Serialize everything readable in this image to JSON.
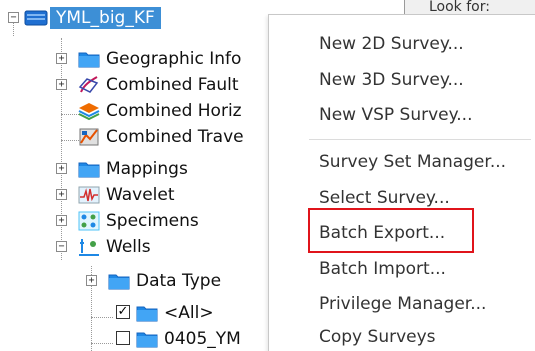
{
  "tree": {
    "root": {
      "label": "YML_big_KF",
      "expander": "−"
    },
    "items": [
      {
        "label": "Geographic Info",
        "expander": "+"
      },
      {
        "label": "Combined Fault",
        "expander": "+"
      },
      {
        "label": "Combined Horiz",
        "expander": ""
      },
      {
        "label": "Combined Trave",
        "expander": ""
      },
      {
        "label": "Mappings",
        "expander": "+"
      },
      {
        "label": "Wavelet",
        "expander": "+"
      },
      {
        "label": "Specimens",
        "expander": "+"
      },
      {
        "label": "Wells",
        "expander": "−"
      }
    ],
    "wells_children": [
      {
        "label": "Data Type",
        "expander": "+"
      },
      {
        "label": "<All>",
        "checked": "✓"
      },
      {
        "label": "0405_YM",
        "checked": ""
      }
    ]
  },
  "lookfor": {
    "label": "Look for:"
  },
  "menu": {
    "items": [
      {
        "label": "New 2D Survey..."
      },
      {
        "label": "New 3D Survey..."
      },
      {
        "label": "New VSP Survey..."
      },
      {
        "label": "Survey Set Manager..."
      },
      {
        "label": "Select Survey..."
      },
      {
        "label": "Batch Export..."
      },
      {
        "label": "Batch Import..."
      },
      {
        "label": "Privilege Manager..."
      },
      {
        "label": "Copy Surveys"
      }
    ]
  },
  "colors": {
    "selection": "#3d8fd6",
    "highlight_border": "#e0141b",
    "folder_blue": "#1e88e5"
  }
}
